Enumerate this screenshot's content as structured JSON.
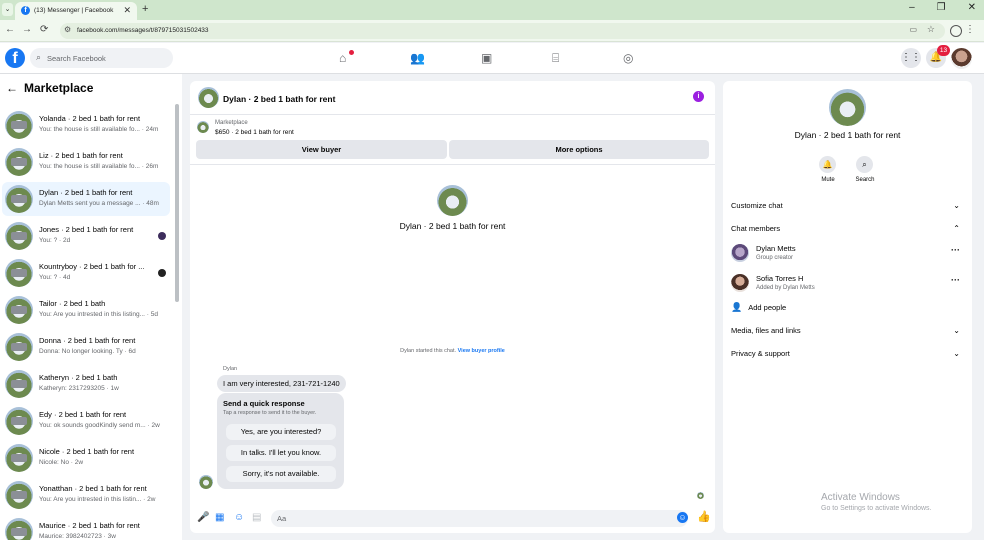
{
  "browser": {
    "tab_title": "(13) Messenger | Facebook",
    "url": "facebook.com/messages/t/879715031502433",
    "new_tab": "+",
    "tab_close": "✕",
    "back": "←",
    "forward": "→",
    "reload": "⟳",
    "window_buttons": [
      "–",
      "❐",
      "✕"
    ]
  },
  "fb": {
    "logo": "f",
    "search_placeholder": "Search Facebook",
    "notification_count": "13"
  },
  "sidebar": {
    "title": "Marketplace",
    "conversations": [
      {
        "name": "Yolanda · 2 bed 1 bath for rent",
        "preview": "You: the house is still available fo... · 24m",
        "active": false,
        "seen": ""
      },
      {
        "name": "Liz · 2 bed 1 bath for rent",
        "preview": "You: the house is still available fo... · 26m",
        "active": false,
        "seen": ""
      },
      {
        "name": "Dylan · 2 bed 1 bath for rent",
        "preview": "Dylan Metts sent you a message ... · 48m",
        "active": true,
        "seen": ""
      },
      {
        "name": "Jones · 2 bed 1 bath for rent",
        "preview": "You: ? · 2d",
        "active": false,
        "seen": "a"
      },
      {
        "name": "Kountryboy · 2 bed 1 bath for ...",
        "preview": "You: ? · 4d",
        "active": false,
        "seen": "b"
      },
      {
        "name": "Tailor · 2 bed 1 bath",
        "preview": "You: Are you intrested in this listing... · 5d",
        "active": false,
        "seen": ""
      },
      {
        "name": "Donna · 2 bed 1 bath for rent",
        "preview": "Donna: No longer looking. Ty · 6d",
        "active": false,
        "seen": ""
      },
      {
        "name": "Katheryn · 2 bed 1 bath",
        "preview": "Katheryn: 2317293205 · 1w",
        "active": false,
        "seen": ""
      },
      {
        "name": "Edy · 2 bed 1 bath for rent",
        "preview": "You: ok sounds goodKindly send m... · 2w",
        "active": false,
        "seen": ""
      },
      {
        "name": "Nicole · 2 bed 1 bath for rent",
        "preview": "Nicole: No · 2w",
        "active": false,
        "seen": ""
      },
      {
        "name": "Yonatthan · 2 bed 1 bath for rent",
        "preview": "You: Are you intrested in this listin... · 2w",
        "active": false,
        "seen": ""
      },
      {
        "name": "Maurice · 2 bed 1 bath for rent",
        "preview": "Maurice: 3982402723 · 3w",
        "active": false,
        "seen": ""
      }
    ]
  },
  "chat": {
    "title": "Dylan · 2 bed 1 bath for rent",
    "marketplace_label": "Marketplace",
    "listing": "$650 · 2 bed 1 bath for rent",
    "view_buyer": "View buyer",
    "more_options": "More options",
    "center_name": "Dylan · 2 bed 1 bath for rent",
    "started_text": "Dylan started this chat.",
    "view_buyer_profile": "View buyer profile",
    "sender": "Dylan",
    "message": "I am very interested, 231-721-1240",
    "quick_title": "Send a quick response",
    "quick_sub": "Tap a response to send it to the buyer.",
    "quick_options": [
      "Yes, are you interested?",
      "In talks. I'll let you know.",
      "Sorry, it's not available."
    ],
    "composer_placeholder": "Aa"
  },
  "panel": {
    "name": "Dylan · 2 bed 1 bath for rent",
    "mute": "Mute",
    "search": "Search",
    "customize": "Customize chat",
    "members_title": "Chat members",
    "members": [
      {
        "name": "Dylan Metts",
        "role": "Group creator"
      },
      {
        "name": "Sofia Torres H",
        "role": "Added by Dylan Metts"
      }
    ],
    "add_people": "Add people",
    "media": "Media, files and links",
    "privacy": "Privacy & support"
  },
  "watermark": {
    "line1": "Activate Windows",
    "line2": "Go to Settings to activate Windows."
  }
}
